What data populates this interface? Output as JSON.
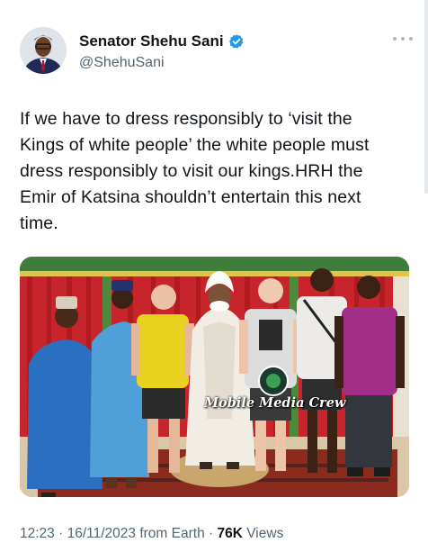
{
  "author": {
    "name": "Senator Shehu Sani",
    "handle": "@ShehuSani",
    "verified": true
  },
  "tweet": {
    "text_lines": [
      "If we have to dress responsibly to ‘visit the",
      "Kings of white people’ the white people must",
      "dress responsibly to visit our kings.HRH the",
      "Emir of Katsina shouldn’t entertain this next",
      "time."
    ],
    "image_watermark": "Mobile Media Crew"
  },
  "meta": {
    "time": "12:23",
    "date": "16/11/2023",
    "source": "from Earth",
    "separator": "·",
    "views_count": "76K",
    "views_label": "Views"
  },
  "icons": {
    "verified": "verified-badge-icon",
    "more": "more-options-icon"
  },
  "colors": {
    "verified_blue": "#1d9bf0",
    "secondary_text": "#536471",
    "primary_text": "#0f1419"
  }
}
